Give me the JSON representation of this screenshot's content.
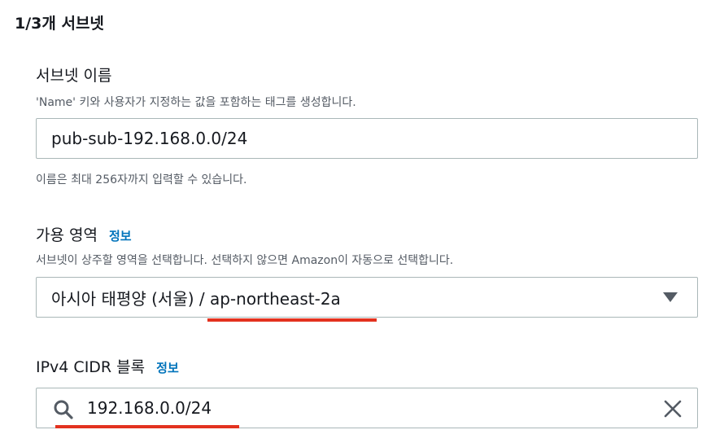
{
  "section": {
    "title": "1/3개 서브넷"
  },
  "subnet_name": {
    "label": "서브넷 이름",
    "description": "'Name' 키와 사용자가 지정하는 값을 포함하는 태그를 생성합니다.",
    "value": "pub-sub-192.168.0.0/24",
    "constraint": "이름은 최대 256자까지 입력할 수 있습니다."
  },
  "availability_zone": {
    "label": "가용 영역",
    "info_link": "정보",
    "description": "서브넷이 상주할 영역을 선택합니다. 선택하지 않으면 Amazon이 자동으로 선택합니다.",
    "selected": "아시아 태평양 (서울) / ap-northeast-2a",
    "arrow_icon": "caret-down-icon"
  },
  "ipv4_cidr": {
    "label": "IPv4 CIDR 블록",
    "info_link": "정보",
    "value": "192.168.0.0/24",
    "search_icon": "search-icon",
    "clear_icon": "close-icon"
  },
  "colors": {
    "annotation_underline": "#e3321f",
    "link": "#0073bb",
    "input_border": "#aab7b8",
    "secondary_text": "#545b64"
  }
}
